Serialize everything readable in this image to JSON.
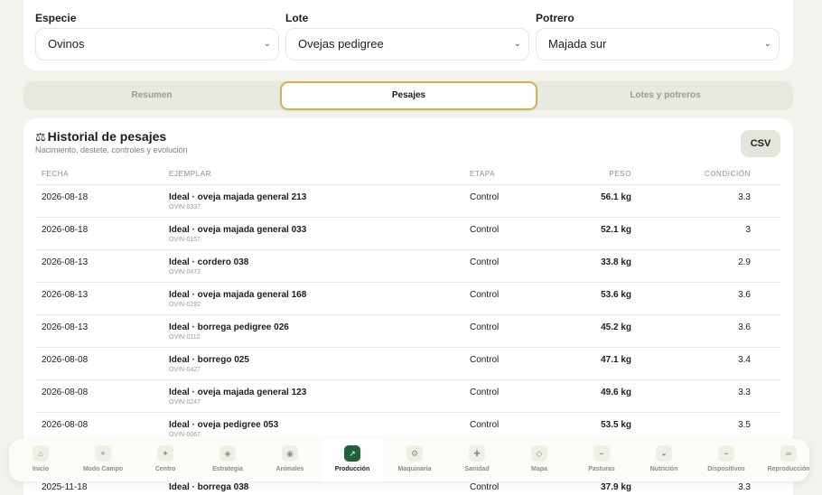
{
  "filters": {
    "especie": {
      "label": "Especie",
      "value": "Ovinos"
    },
    "lote": {
      "label": "Lote",
      "value": "Ovejas pedigree"
    },
    "potrero": {
      "label": "Potrero",
      "value": "Majada sur"
    }
  },
  "tabs": [
    {
      "label": "Resumen",
      "active": false
    },
    {
      "label": "Pesajes",
      "active": true
    },
    {
      "label": "Lotes y potreros",
      "active": false
    }
  ],
  "historial": {
    "icon": "scale-icon",
    "title": "Historial de pesajes",
    "subtitle": "Nacimiento, destete, controles y evolución",
    "csv_label": "CSV",
    "headers": {
      "fecha": "FECHA",
      "ejemplar": "EJEMPLAR",
      "etapa": "ETAPA",
      "peso": "PESO",
      "condicion": "CONDICIÓN"
    },
    "rows": [
      {
        "fecha": "2026-08-18",
        "ejemplar": "Ideal · oveja majada general 213",
        "codigo": "OVIN-0337",
        "etapa": "Control",
        "peso": "56.1 kg",
        "condicion": "3.3"
      },
      {
        "fecha": "2026-08-18",
        "ejemplar": "Ideal · oveja majada general 033",
        "codigo": "OVIN-0157",
        "etapa": "Control",
        "peso": "52.1 kg",
        "condicion": "3"
      },
      {
        "fecha": "2026-08-13",
        "ejemplar": "Ideal · cordero 038",
        "codigo": "OVIN-0472",
        "etapa": "Control",
        "peso": "33.8 kg",
        "condicion": "2.9"
      },
      {
        "fecha": "2026-08-13",
        "ejemplar": "Ideal · oveja majada general 168",
        "codigo": "OVIN-0292",
        "etapa": "Control",
        "peso": "53.6 kg",
        "condicion": "3.6"
      },
      {
        "fecha": "2026-08-13",
        "ejemplar": "Ideal · borrega pedigree 026",
        "codigo": "OVIN-0112",
        "etapa": "Control",
        "peso": "45.2 kg",
        "condicion": "3.6"
      },
      {
        "fecha": "2026-08-08",
        "ejemplar": "Ideal · borrego 025",
        "codigo": "OVIN-0427",
        "etapa": "Control",
        "peso": "47.1 kg",
        "condicion": "3.4"
      },
      {
        "fecha": "2026-08-08",
        "ejemplar": "Ideal · oveja majada general 123",
        "codigo": "OVIN-0247",
        "etapa": "Control",
        "peso": "49.6 kg",
        "condicion": "3.3"
      },
      {
        "fecha": "2026-08-08",
        "ejemplar": "Ideal · oveja pedigree 053",
        "codigo": "OVIN-0067",
        "etapa": "Control",
        "peso": "53.5 kg",
        "condicion": "3.5"
      }
    ],
    "partial_row": {
      "fecha": "2025-11-18",
      "ejemplar": "Ideal · borrega 038",
      "etapa": "Control",
      "peso": "37.9 kg",
      "condicion": "3.3"
    }
  },
  "nav": [
    {
      "label": "Inicio",
      "icon": "home-icon",
      "glyph": "⌂",
      "active": false
    },
    {
      "label": "Modo Campo",
      "icon": "crosshair-icon",
      "glyph": "⌖",
      "active": false
    },
    {
      "label": "Centro",
      "icon": "sparkle-icon",
      "glyph": "✦",
      "active": false
    },
    {
      "label": "Estrategia",
      "icon": "diamond-target-icon",
      "glyph": "◈",
      "active": false
    },
    {
      "label": "Animales",
      "icon": "circle-dot-icon",
      "glyph": "◉",
      "active": false
    },
    {
      "label": "Producción",
      "icon": "arrow-up-right-icon",
      "glyph": "↗",
      "active": true
    },
    {
      "label": "Maquinaria",
      "icon": "gear-icon",
      "glyph": "⚙",
      "active": false
    },
    {
      "label": "Sanidad",
      "icon": "plus-cross-icon",
      "glyph": "✚",
      "active": false
    },
    {
      "label": "Mapa",
      "icon": "diamond-icon",
      "glyph": "◇",
      "active": false
    },
    {
      "label": "Pasturas",
      "icon": "leaf-icon",
      "glyph": "⌁",
      "active": false
    },
    {
      "label": "Nutrición",
      "icon": "half-circle-icon",
      "glyph": "◒",
      "active": false
    },
    {
      "label": "Dispositivos",
      "icon": "signal-icon",
      "glyph": "⌁",
      "active": false
    },
    {
      "label": "Reproducción",
      "icon": "infinity-icon",
      "glyph": "∞",
      "active": false
    }
  ]
}
